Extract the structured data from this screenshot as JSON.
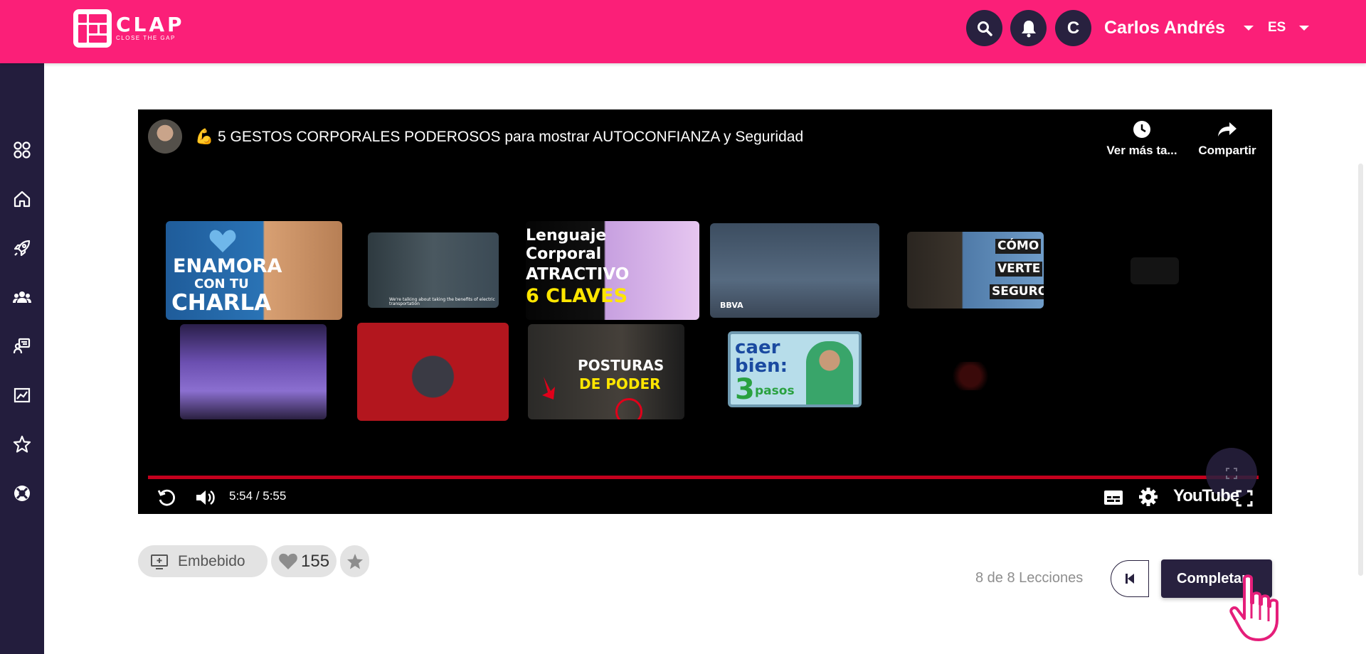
{
  "header": {
    "logo_name": "CLAP",
    "logo_tagline": "CLOSE THE GAP",
    "avatar_initial": "C",
    "user_name": "Carlos Andrés",
    "language": "ES",
    "accent_color": "#fb1f78",
    "dark_color": "#28213f"
  },
  "sidebar": {
    "items": [
      {
        "icon": "apps-grid-icon"
      },
      {
        "icon": "home-icon"
      },
      {
        "icon": "rocket-icon"
      },
      {
        "icon": "groups-icon"
      },
      {
        "icon": "reader-icon"
      },
      {
        "icon": "analytics-icon"
      },
      {
        "icon": "star-icon"
      },
      {
        "icon": "support-icon"
      }
    ]
  },
  "video": {
    "title": "💪 5 GESTOS CORPORALES PODEROSOS para mostrar AUTOCONFIANZA y Seguridad",
    "watch_later": "Ver más ta...",
    "share": "Compartir",
    "time": "5:54 / 5:55",
    "progress": 0.997,
    "platform": "YouTube",
    "end_screen": {
      "t1_line1": "ENAMORA",
      "t1_line2": "CON TU",
      "t1_line3": "CHARLA",
      "t2_caption": "We're talking about taking the benefits of electric transportation",
      "t3_line1": "Lenguaje",
      "t3_line2": "Corporal",
      "t3_line3": "ATRACTIVO",
      "t3_line4": "6 CLAVES",
      "t4_label": "BBVA",
      "t5_line1": "CÓMO",
      "t5_line2": "VERTE",
      "t5_line3": "SEGURO",
      "t8_line1": "POSTURAS",
      "t8_line2": "DE PODER",
      "t9_line1": "caer",
      "t9_line2": "bien:",
      "t9_num": "3",
      "t9_word": "pasos"
    }
  },
  "actions": {
    "embed_label": "Embebido",
    "likes": "155"
  },
  "navigation": {
    "lessons": "8 de 8 Lecciones",
    "complete_label": "Completar"
  }
}
